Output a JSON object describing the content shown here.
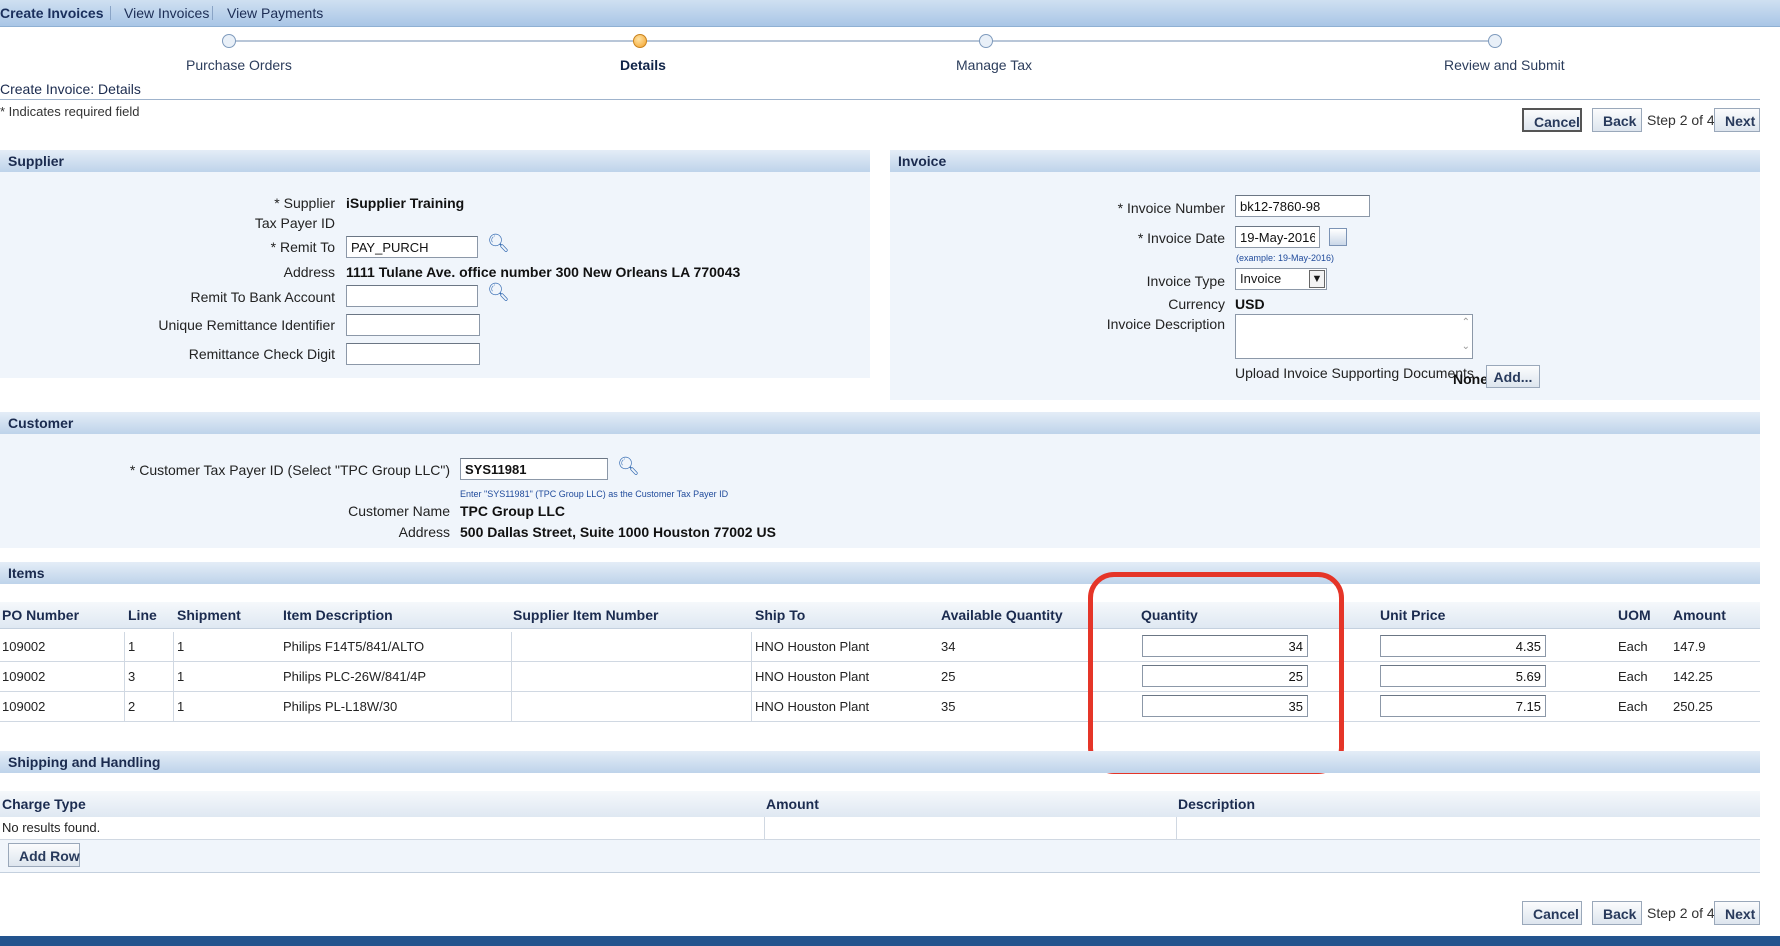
{
  "tabs": [
    {
      "label": "Create Invoices",
      "active": true
    },
    {
      "label": "View Invoices",
      "active": false
    },
    {
      "label": "View Payments",
      "active": false
    }
  ],
  "train": {
    "steps": [
      {
        "label": "Purchase Orders",
        "current": false
      },
      {
        "label": "Details",
        "current": true
      },
      {
        "label": "Manage Tax",
        "current": false
      },
      {
        "label": "Review and Submit",
        "current": false
      }
    ]
  },
  "page": {
    "title": "Create Invoice: Details",
    "required_note": "* Indicates required field"
  },
  "nav": {
    "cancel": "Cancel",
    "back": "Back",
    "step": "Step 2 of 4",
    "next": "Next"
  },
  "supplier": {
    "header": "Supplier",
    "supplier_label": "* Supplier",
    "supplier_value": "iSupplier Training",
    "taxpayer_label": "Tax Payer ID",
    "remit_label": "* Remit To",
    "remit_value": "PAY_PURCH",
    "address_label": "Address",
    "address_value": "1111 Tulane Ave. office number 300 New Orleans LA 770043",
    "bank_label": "Remit To Bank Account",
    "bank_value": "",
    "uri_label": "Unique Remittance Identifier",
    "uri_value": "",
    "check_label": "Remittance Check Digit",
    "check_value": ""
  },
  "invoice": {
    "header": "Invoice",
    "number_label": "* Invoice Number",
    "number_value": "bk12-7860-98",
    "date_label": "* Invoice Date",
    "date_value": "19-May-2016",
    "date_hint": "(example: 19-May-2016)",
    "type_label": "Invoice Type",
    "type_value": "Invoice",
    "currency_label": "Currency",
    "currency_value": "USD",
    "desc_label": "Invoice Description",
    "upload_label": "Upload Invoice Supporting Documents",
    "upload_value": "None",
    "add_button": "Add..."
  },
  "customer": {
    "header": "Customer",
    "taxpayer_label": "* Customer Tax Payer ID (Select \"TPC Group LLC\")",
    "taxpayer_value": "SYS11981",
    "hint": "Enter \"SYS11981\" (TPC Group LLC) as the Customer Tax Payer ID",
    "name_label": "Customer Name",
    "name_value": "TPC Group LLC",
    "address_label": "Address",
    "address_value": "500 Dallas Street, Suite 1000 Houston 77002 US"
  },
  "items": {
    "header": "Items",
    "columns": [
      "PO Number",
      "Line",
      "Shipment",
      "Item Description",
      "Supplier Item Number",
      "Ship To",
      "Available Quantity",
      "Quantity",
      "Unit Price",
      "UOM",
      "Amount"
    ],
    "rows": [
      {
        "po": "109002",
        "line": "1",
        "shipment": "1",
        "desc": "Philips F14T5/841/ALTO",
        "supplier_item": "",
        "ship_to": "HNO Houston Plant",
        "avail": "34",
        "qty": "34",
        "price": "4.35",
        "uom": "Each",
        "amount": "147.9"
      },
      {
        "po": "109002",
        "line": "3",
        "shipment": "1",
        "desc": "Philips PLC-26W/841/4P",
        "supplier_item": "",
        "ship_to": "HNO Houston Plant",
        "avail": "25",
        "qty": "25",
        "price": "5.69",
        "uom": "Each",
        "amount": "142.25"
      },
      {
        "po": "109002",
        "line": "2",
        "shipment": "1",
        "desc": "Philips PL-L18W/30",
        "supplier_item": "",
        "ship_to": "HNO Houston Plant",
        "avail": "35",
        "qty": "35",
        "price": "7.15",
        "uom": "Each",
        "amount": "250.25"
      }
    ]
  },
  "shipping": {
    "header": "Shipping and Handling",
    "columns": [
      "Charge Type",
      "Amount",
      "Description"
    ],
    "empty": "No results found.",
    "add_row": "Add Row"
  },
  "colors": {
    "highlight": "#e53528",
    "header_blue": "#bed3ea"
  }
}
